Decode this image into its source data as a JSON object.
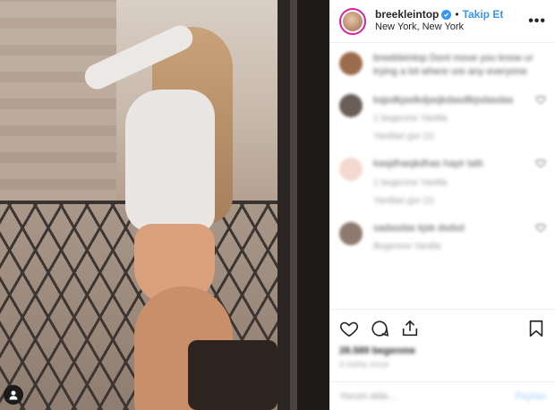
{
  "header": {
    "username": "breekleintop",
    "follow_label": "Takip Et",
    "separator": "•",
    "location": "New York, New York",
    "more_label": "•••"
  },
  "caption": {
    "text": "breekleintop Dont move you know ur trying a lot where ure any everyone"
  },
  "comments": [
    {
      "text": "kajsdkjaslkdjasjkdasdlkjsdasdas",
      "meta": "1 begenme   Yanitla",
      "sub": "Yanitlari gor (1)",
      "color": "#6b5d57"
    },
    {
      "text": "kasjdhasjkdhas hayir tatlı",
      "meta": "1 begenme   Yanitla",
      "sub": "Yanitlari gor (1)",
      "color": "#f4d9d0"
    },
    {
      "text": "sadasdas kjsk dsdsd",
      "meta": "Begenme   Yanitla",
      "sub": "",
      "color": "#8d7a6e"
    }
  ],
  "actions": {
    "likes": "28.589 begenme",
    "date": "3 hafta once"
  },
  "add_comment": {
    "placeholder": "Yorum ekle...",
    "post_label": "Paylas"
  }
}
